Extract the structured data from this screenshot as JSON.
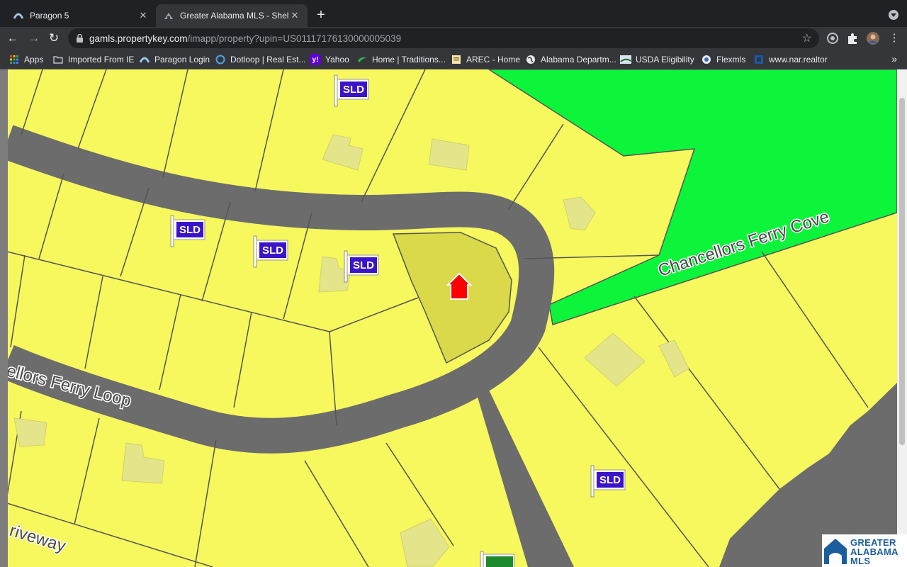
{
  "browser": {
    "tabs": [
      {
        "title": "Paragon 5",
        "active": false
      },
      {
        "title": "Greater Alabama MLS - Shelby",
        "active": true
      }
    ],
    "new_tab_label": "+",
    "url": {
      "host": "gamls.propertykey.com",
      "path": "/imapp/property?upin=US01117176130000005039"
    },
    "bookmarks": [
      {
        "label": "Apps",
        "icon": "apps-grid-icon"
      },
      {
        "label": "Imported From IE",
        "icon": "folder-icon"
      },
      {
        "label": "Paragon Login",
        "icon": "paragon-icon"
      },
      {
        "label": "Dotloop | Real Est...",
        "icon": "dotloop-icon"
      },
      {
        "label": "Yahoo",
        "icon": "yahoo-icon"
      },
      {
        "label": "Home | Traditions...",
        "icon": "traditions-icon"
      },
      {
        "label": "AREC - Home",
        "icon": "arec-icon"
      },
      {
        "label": "Alabama Departm...",
        "icon": "globe-icon"
      },
      {
        "label": "USDA Eligibility",
        "icon": "usda-icon"
      },
      {
        "label": "Flexmls",
        "icon": "flexmls-icon"
      },
      {
        "label": "www.nar.realtor",
        "icon": "nar-icon"
      }
    ],
    "more_bookmarks_label": "»"
  },
  "map": {
    "streets": [
      "ellors Ferry Loop",
      "Chancellors Ferry Cove",
      "riveway"
    ],
    "sold_marker_label": "SLD",
    "subject_marker": "red-house-icon",
    "colors": {
      "parcel": "#f7f75e",
      "road": "#6c6c6c",
      "green_space": "#0cf53b",
      "building": "#e4e48a",
      "subject_parcel": "#d9d94a",
      "subject_house": "#ff0000",
      "sld_flag": "#3a14c8"
    }
  },
  "logo": {
    "line1": "GREATER",
    "line2": "ALABAMA",
    "line3": "MLS"
  }
}
